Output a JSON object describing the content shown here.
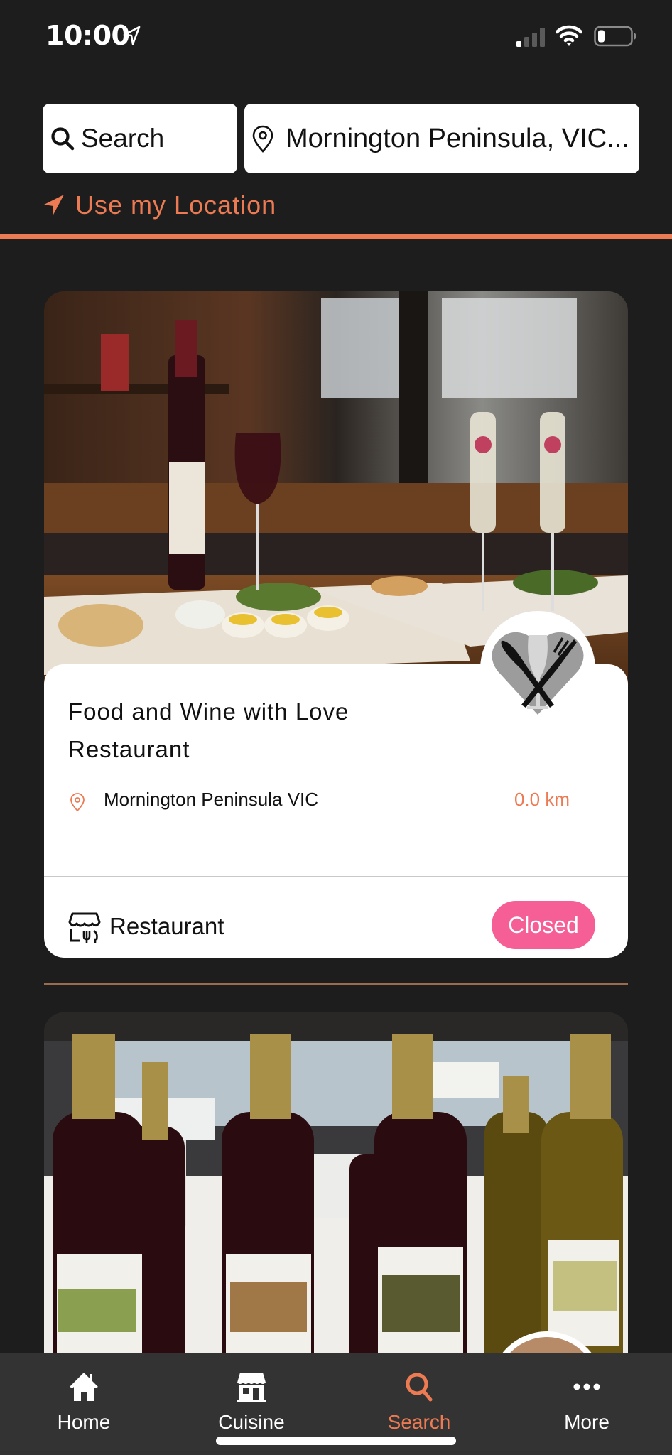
{
  "status_bar": {
    "time": "10:00",
    "icons": [
      "location-arrow-icon",
      "cellular-signal-icon",
      "wifi-icon",
      "battery-low-icon"
    ]
  },
  "search": {
    "label": "Search",
    "icon": "search-icon"
  },
  "location": {
    "value": "Mornington Peninsula, VIC...",
    "icon": "map-pin-icon"
  },
  "use_location": {
    "label": "Use my Location",
    "icon": "location-arrow-icon"
  },
  "colors": {
    "accent": "#ec7a52",
    "background": "#1d1d1d",
    "tab_bar": "#333333",
    "status_closed": "#f55f96"
  },
  "listings": [
    {
      "title": "Food and Wine with Love Restaurant",
      "address": "Mornington Peninsula VIC",
      "distance": "0.0 km",
      "type": "Restaurant",
      "status": "Closed",
      "image": "wine-and-food-table-photo",
      "badge": "heart-cutlery-wine-icon"
    },
    {
      "image": "wine-bottles-display-photo"
    }
  ],
  "tab_bar": {
    "tabs": [
      {
        "label": "Home",
        "icon": "home-icon",
        "active": false
      },
      {
        "label": "Cuisine",
        "icon": "storefront-icon",
        "active": false
      },
      {
        "label": "Search",
        "icon": "search-icon",
        "active": true
      },
      {
        "label": "More",
        "icon": "more-dots-icon",
        "active": false
      }
    ]
  }
}
